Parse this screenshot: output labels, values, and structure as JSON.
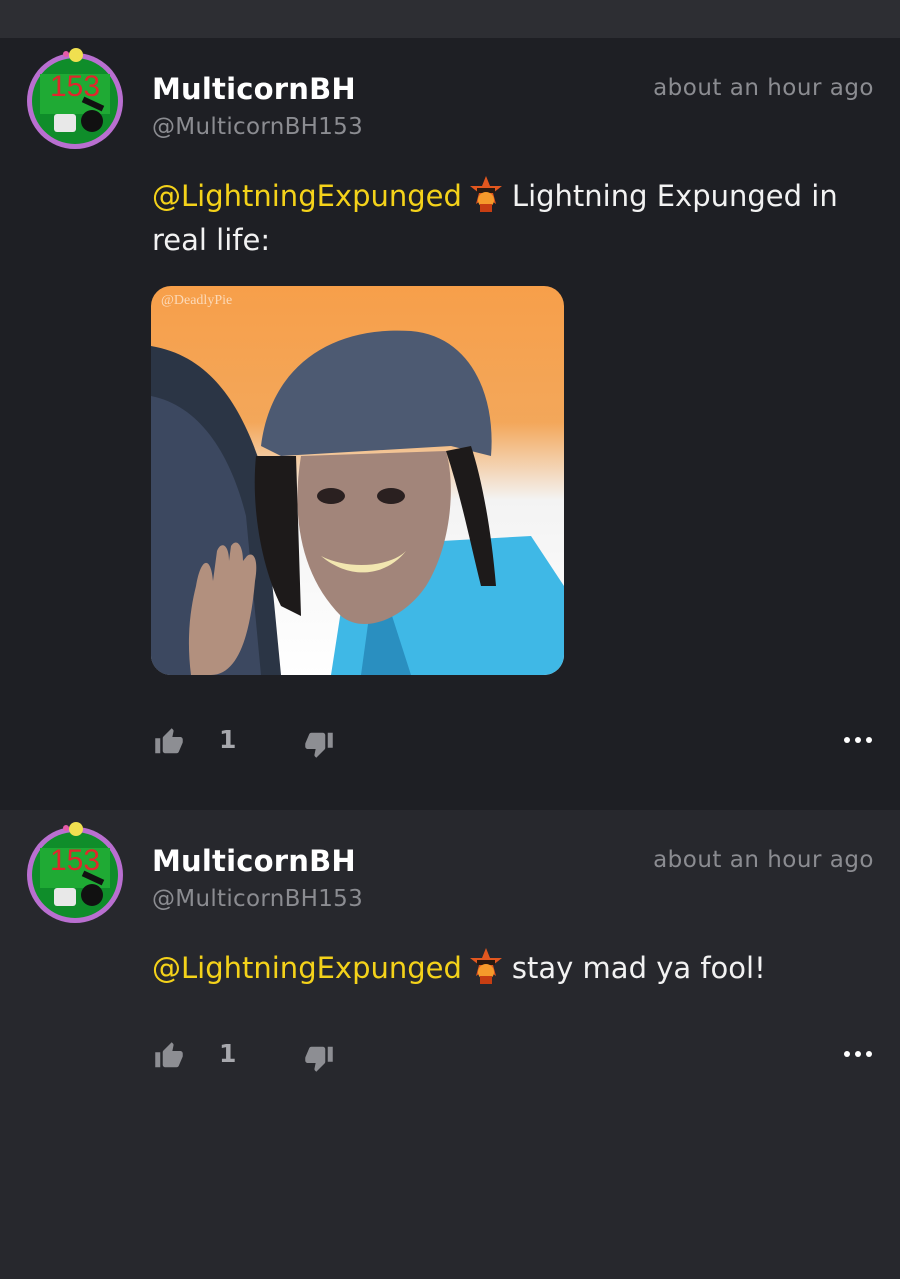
{
  "posts": [
    {
      "author": "MulticornBH",
      "handle": "@MulticornBH153",
      "time": "about an hour ago",
      "avatar_number": "153",
      "mention": "@LightningExpunged",
      "text": "Lightning Expunged in real life:",
      "image_watermark": "@DeadlyPie",
      "likes": "1"
    },
    {
      "author": "MulticornBH",
      "handle": "@MulticornBH153",
      "time": "about an hour ago",
      "avatar_number": "153",
      "mention": "@LightningExpunged",
      "text": "stay mad ya fool!",
      "likes": "1"
    }
  ],
  "icons": {
    "like": "thumbs-up-icon",
    "dislike": "thumbs-down-icon",
    "more": "more-options-icon"
  },
  "colors": {
    "background": "#27282d",
    "post_highlight": "#1e1f24",
    "mention": "#f4d21a",
    "muted": "#8b8c91"
  }
}
